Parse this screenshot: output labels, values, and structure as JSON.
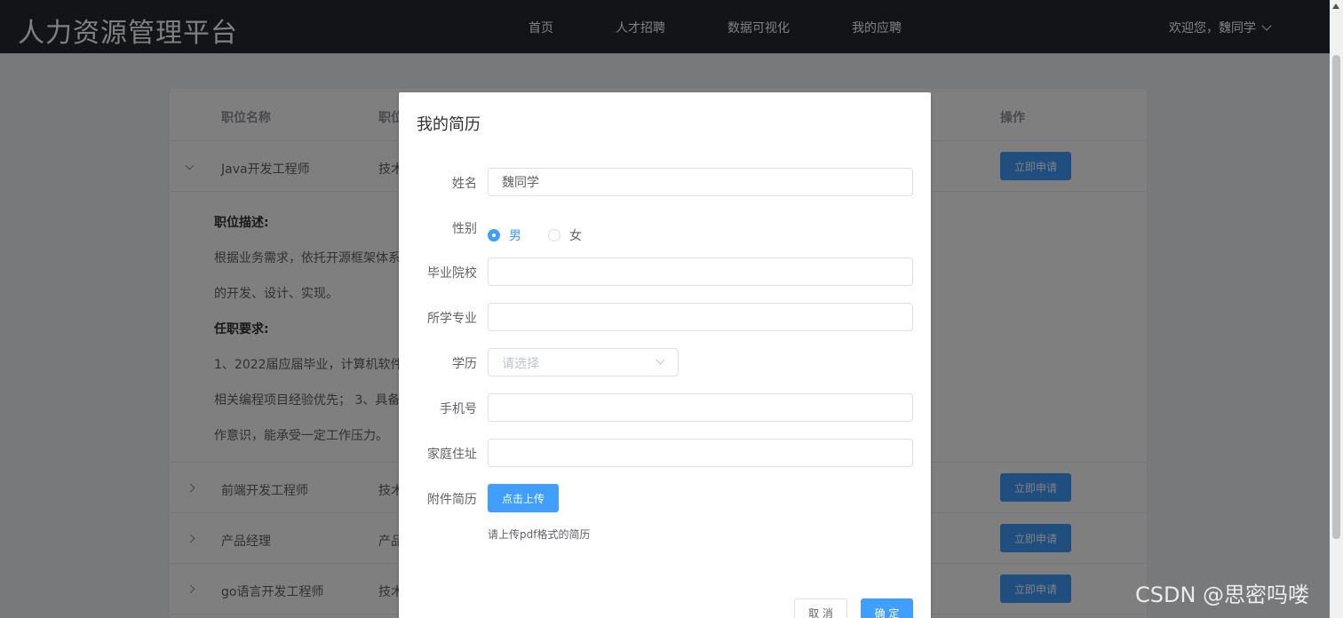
{
  "header": {
    "brand": "人力资源管理平台",
    "nav": [
      "首页",
      "人才招聘",
      "数据可视化",
      "我的应聘"
    ],
    "user_greeting": "欢迎您，魏同学"
  },
  "table": {
    "columns": [
      "职位名称",
      "职位",
      "操作"
    ],
    "rows": [
      {
        "name": "Java开发工程师",
        "type": "技术",
        "action": "立即申请",
        "expanded": true
      },
      {
        "name": "前端开发工程师",
        "type": "技术",
        "action": "立即申请",
        "expanded": false
      },
      {
        "name": "产品经理",
        "type": "产品",
        "action": "立即申请",
        "expanded": false
      },
      {
        "name": "go语言开发工程师",
        "type": "技术",
        "action": "立即申请",
        "expanded": false
      }
    ],
    "expanded_detail": {
      "desc_title": "职位描述:",
      "desc_line1": "根据业务需求，依托开源框架体系",
      "desc_line2": "的开发、设计、实现。",
      "req_title": "任职要求:",
      "req_line1": "1、2022届应届毕业，计算机软件",
      "req_line2": "相关编程项目经验优先；  3、具备",
      "req_line3": "作意识，能承受一定工作压力。"
    }
  },
  "dialog": {
    "title": "我的简历",
    "fields": {
      "name_label": "姓名",
      "name_value": "魏同学",
      "gender_label": "性别",
      "gender_male": "男",
      "gender_female": "女",
      "gender_selected": "男",
      "school_label": "毕业院校",
      "school_value": "",
      "major_label": "所学专业",
      "major_value": "",
      "edu_label": "学历",
      "edu_placeholder": "请选择",
      "phone_label": "手机号",
      "phone_value": "",
      "address_label": "家庭住址",
      "address_value": "",
      "attach_label": "附件简历",
      "upload_button": "点击上传",
      "upload_tip": "请上传pdf格式的简历"
    },
    "cancel_button": "取 消",
    "confirm_button": "确 定"
  },
  "watermark": "CSDN @思密吗喽",
  "colors": {
    "primary": "#409eff",
    "header_bg": "#262930",
    "overlay": "rgba(0,0,0,0.5)"
  }
}
